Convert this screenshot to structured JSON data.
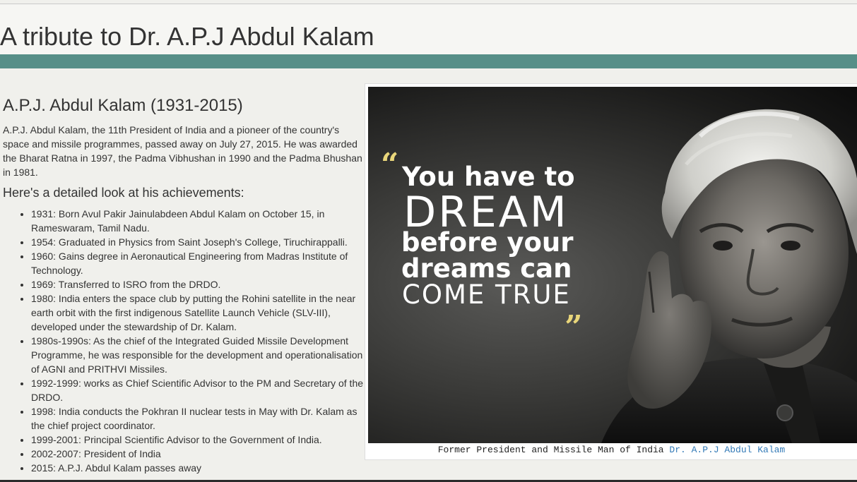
{
  "header": {
    "title": "A tribute to Dr. A.P.J Abdul Kalam"
  },
  "colors": {
    "accent_band": "#578f88",
    "link": "#337ab7"
  },
  "main": {
    "heading": "A.P.J. Abdul Kalam (1931-2015)",
    "intro": "A.P.J. Abdul Kalam, the 11th President of India and a pioneer of the country's space and missile programmes, passed away on July 27, 2015. He was awarded the Bharat Ratna in 1997, the Padma Vibhushan in 1990 and the Padma Bhushan in 1981.",
    "subheading": "Here's a detailed look at his achievements:",
    "achievements": [
      "1931: Born Avul Pakir Jainulabdeen Abdul Kalam on October 15, in Rameswaram, Tamil Nadu.",
      "1954: Graduated in Physics from Saint Joseph's College, Tiruchirappalli.",
      "1960: Gains degree in Aeronautical Engineering from Madras Institute of Technology.",
      "1969: Transferred to ISRO from the DRDO.",
      "1980: India enters the space club by putting the Rohini satellite in the near earth orbit with the first indigenous Satellite Launch Vehicle (SLV-III), developed under the stewardship of Dr. Kalam.",
      "1980s-1990s: As the chief of the Integrated Guided Missile Development Programme, he was responsible for the development and operationalisation of AGNI and PRITHVI Missiles.",
      "1992-1999: works as Chief Scientific Advisor to the PM and Secretary of the DRDO.",
      "1998: India conducts the Pokhran II nuclear tests in May with Dr. Kalam as the chief project coordinator.",
      "1999-2001: Principal Scientific Advisor to the Government of India.",
      "2002-2007: President of India",
      "2015: A.P.J. Abdul Kalam passes away"
    ]
  },
  "figure": {
    "quote": {
      "open_mark": "“",
      "line1": "You have to",
      "line2": "DREAM",
      "line3": "before your",
      "line4": "dreams can",
      "line5": "COME TRUE",
      "close_mark": "„"
    },
    "caption_text": "Former President and Missile Man of India ",
    "caption_link": "Dr. A.P.J Abdul Kalam"
  }
}
